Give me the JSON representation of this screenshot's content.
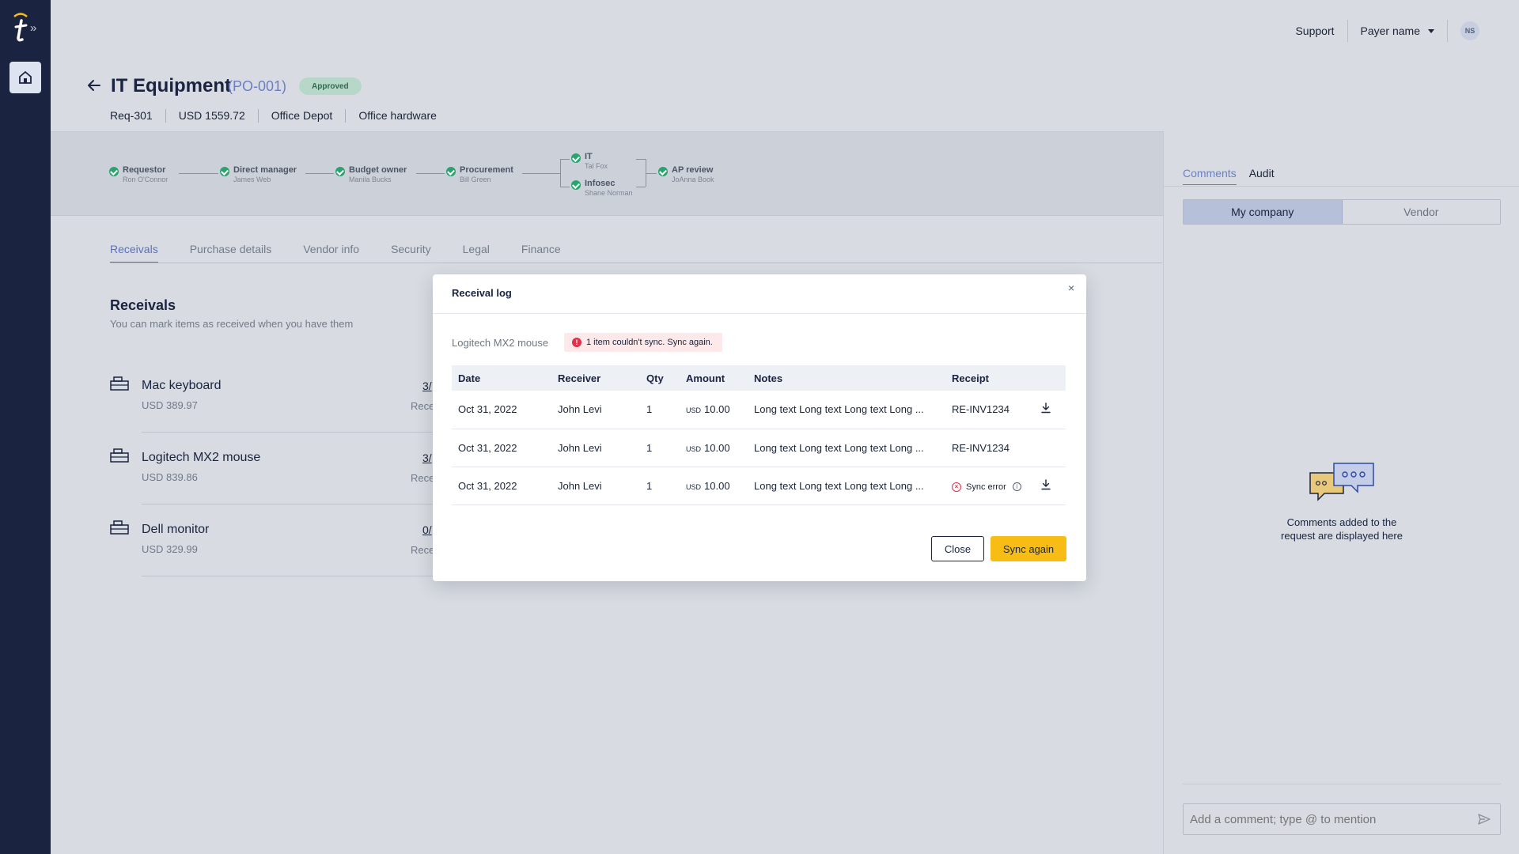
{
  "topnav": {
    "support": "Support",
    "payer": "Payer name",
    "avatar": "NS"
  },
  "header": {
    "title": "IT Equipment",
    "po": "(PO-001)",
    "status": "Approved",
    "meta": [
      "Req-301",
      "USD 1559.72",
      "Office Depot",
      "Office hardware"
    ]
  },
  "flow": {
    "steps": [
      {
        "role": "Requestor",
        "who": "Ron O'Connor"
      },
      {
        "role": "Direct manager",
        "who": "James Web"
      },
      {
        "role": "Budget owner",
        "who": "Manila Bucks"
      },
      {
        "role": "Procurement",
        "who": "Bill Green"
      },
      {
        "role": "IT",
        "who": "Tal Fox"
      },
      {
        "role": "Infosec",
        "who": "Shane Norman"
      },
      {
        "role": "AP review",
        "who": "JoAnna Book"
      }
    ]
  },
  "tabs": [
    "Receivals",
    "Purchase details",
    "Vendor info",
    "Security",
    "Legal",
    "Finance"
  ],
  "receivals": {
    "title": "Receivals",
    "subtitle": "You can mark items as received when you have them",
    "items": [
      {
        "name": "Mac keyboard",
        "price": "USD 389.97",
        "qty": "3/",
        "label": "Rece"
      },
      {
        "name": "Logitech MX2 mouse",
        "price": "USD 839.86",
        "qty": "3/",
        "label": "Rece"
      },
      {
        "name": "Dell monitor",
        "price": "USD 329.99",
        "qty": "0/",
        "label": "Rece"
      }
    ]
  },
  "right_panel": {
    "tabs": [
      "Comments",
      "Audit"
    ],
    "segments": [
      "My company",
      "Vendor"
    ],
    "empty_line1": "Comments added to the",
    "empty_line2": "request are displayed here",
    "comment_placeholder": "Add a comment; type @ to mention"
  },
  "modal": {
    "title": "Receival log",
    "close_icon": "×",
    "product": "Logitech MX2 mouse",
    "error_icon": "!",
    "error_text": "1 item couldn't sync. Sync again.",
    "columns": [
      "Date",
      "Receiver",
      "Qty",
      "Amount",
      "Notes",
      "Receipt"
    ],
    "rows": [
      {
        "date": "Oct 31, 2022",
        "receiver": "John Levi",
        "qty": "1",
        "currency": "USD",
        "amount": "10.00",
        "notes": "Long text Long text Long text Long  ...",
        "receipt": "RE-INV1234",
        "download": true
      },
      {
        "date": "Oct 31, 2022",
        "receiver": "John Levi",
        "qty": "1",
        "currency": "USD",
        "amount": "10.00",
        "notes": "Long text Long text Long text Long  ...",
        "receipt": "RE-INV1234",
        "download": false
      },
      {
        "date": "Oct 31, 2022",
        "receiver": "John Levi",
        "qty": "1",
        "currency": "USD",
        "amount": "10.00",
        "notes": "Long text Long text Long text Long  ...",
        "receipt": "Sync error",
        "download": true
      }
    ],
    "sync_error_icon": "×",
    "info_icon": "i",
    "close_label": "Close",
    "sync_label": "Sync again"
  },
  "colors": {
    "rail": "#1a2440",
    "accent": "#5a6fc0",
    "success": "#28a46c",
    "error": "#e0304a",
    "primary_btn": "#f7bd14"
  }
}
